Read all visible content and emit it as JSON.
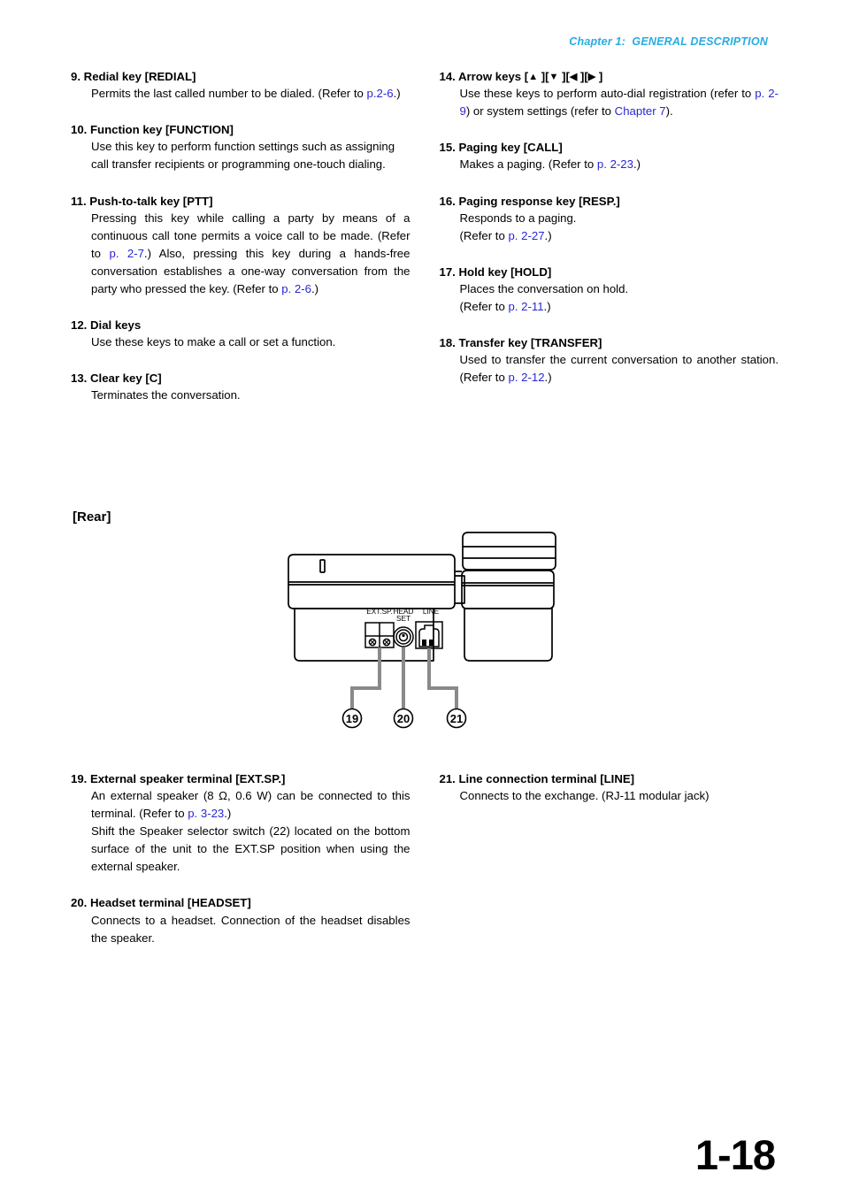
{
  "header": {
    "text": "Chapter 1:  GENERAL DESCRIPTION",
    "color": "#29abe2"
  },
  "link_color": "#2727d6",
  "upper_left_column": [
    {
      "number": "9.",
      "title": "Redial key [REDIAL]",
      "body_plain": "Permits the last called number to be dialed. (Refer to p.2-6.)",
      "body_html": "Permits the last called number to be dialed. (Refer to <span class=\"link\">p.2-6</span>.)",
      "justify": true
    },
    {
      "number": "10.",
      "title": "Function key [FUNCTION]",
      "body_plain": "Use this key to perform function settings such as assigning call transfer recipients or programming one-touch dialing.",
      "body_html": "Use this key to perform function settings such as assigning call transfer recipients or programming one-touch dialing.",
      "justify": false
    },
    {
      "number": "11.",
      "title": "Push-to-talk key [PTT]",
      "body_plain": "Pressing this key while calling a party by means of a continuous call tone permits a voice call to be made. (Refer to p. 2-7.) Also, pressing this key during a hands-free conversation establishes a one-way conversation from the party who pressed the key. (Refer to p. 2-6.)",
      "body_html": "Pressing this key while calling a party by means of a continuous call tone permits a voice call to be made. (Refer to <span class=\"link\">p. 2-7</span>.) Also, pressing this key during a hands-free conversation establishes a one-way conversation from the party who pressed the key. (Refer to <span class=\"link\">p. 2-6</span>.)",
      "justify": true
    },
    {
      "number": "12.",
      "title": "Dial keys",
      "body_plain": "Use these keys to make a call or set a function.",
      "body_html": "Use these keys to make a call or set a function.",
      "justify": false
    },
    {
      "number": "13.",
      "title": "Clear key [C]",
      "body_plain": "Terminates the conversation.",
      "body_html": "Terminates the conversation.",
      "justify": false
    }
  ],
  "upper_right_column": [
    {
      "number": "14.",
      "title": "Arrow keys [▲][▼][◀][▶]",
      "title_html": "Arrow keys [<span class=\"tri\">▲</span> ][<span class=\"tri\">▼</span> ][<span class=\"tri\">◀</span> ][<span class=\"tri\">▶</span> ]",
      "body_plain": "Use these keys to perform auto-dial registration (refer to p. 2-9) or system settings (refer to Chapter 7).",
      "body_html": "Use these keys to perform auto-dial registration (refer to <span class=\"link\">p. 2-9</span>) or system settings (refer to <span class=\"link\">Chapter 7</span>).",
      "justify": true
    },
    {
      "number": "15.",
      "title": "Paging key [CALL]",
      "body_plain": "Makes a paging. (Refer to p. 2-23.)",
      "body_html": "Makes a paging. (Refer to <span class=\"link\">p. 2-23</span>.)",
      "justify": false
    },
    {
      "number": "16.",
      "title": "Paging response key [RESP.]",
      "body_plain": "Responds to a paging. (Refer to p. 2-27.)",
      "body_html": "Responds to a paging.<br>(Refer to <span class=\"link\">p. 2-27</span>.)",
      "justify": false
    },
    {
      "number": "17.",
      "title": "Hold key [HOLD]",
      "body_plain": "Places the conversation on hold. (Refer to p. 2-11.)",
      "body_html": "Places the conversation on hold.<br>(Refer to <span class=\"link\">p. 2-11</span>.)",
      "justify": false
    },
    {
      "number": "18.",
      "title": "Transfer key [TRANSFER]",
      "body_plain": "Used to transfer the current conversation to another station. (Refer to p. 2-12.)",
      "body_html": "Used to transfer the current conversation to another station. (Refer to <span class=\"link\">p. 2-12</span>.)",
      "justify": true
    }
  ],
  "rear_section": {
    "heading": "[Rear]",
    "figure": {
      "port_labels": {
        "ext_sp": "EXT.SP.",
        "headset_line1": "HEAD",
        "headset_line2": "SET",
        "line": "LINE"
      },
      "callouts": [
        "19",
        "20",
        "21"
      ],
      "leader_color": "#8a8a8a",
      "outline_color": "#000000"
    }
  },
  "lower_left_column": [
    {
      "number": "19.",
      "title": "External speaker terminal [EXT.SP.]",
      "body_plain": "An external speaker (8 Ω, 0.6 W) can be connected to this terminal. (Refer to p. 3-23.) Shift the Speaker selector switch (22) located on the bottom surface of the unit to the EXT.SP position when using the external speaker.",
      "body_html": "An external speaker (8 Ω, 0.6 W) can be connected to this terminal. (Refer to <span class=\"link\">p. 3-23</span>.)<br>Shift the Speaker selector switch (22) located on the bottom surface of the unit to the EXT.SP position when using the external speaker.",
      "justify": true
    },
    {
      "number": "20.",
      "title": "Headset terminal [HEADSET]",
      "body_plain": "Connects to a headset. Connection of the headset disables the speaker.",
      "body_html": "Connects to a headset. Connection of the headset disables the speaker.",
      "justify": true
    }
  ],
  "lower_right_column": [
    {
      "number": "21.",
      "title": "Line connection terminal [LINE]",
      "body_plain": "Connects to the exchange. (RJ-11 modular jack)",
      "body_html": "Connects to the exchange. (RJ-11 modular jack)",
      "justify": false
    }
  ],
  "folio": "1-18"
}
